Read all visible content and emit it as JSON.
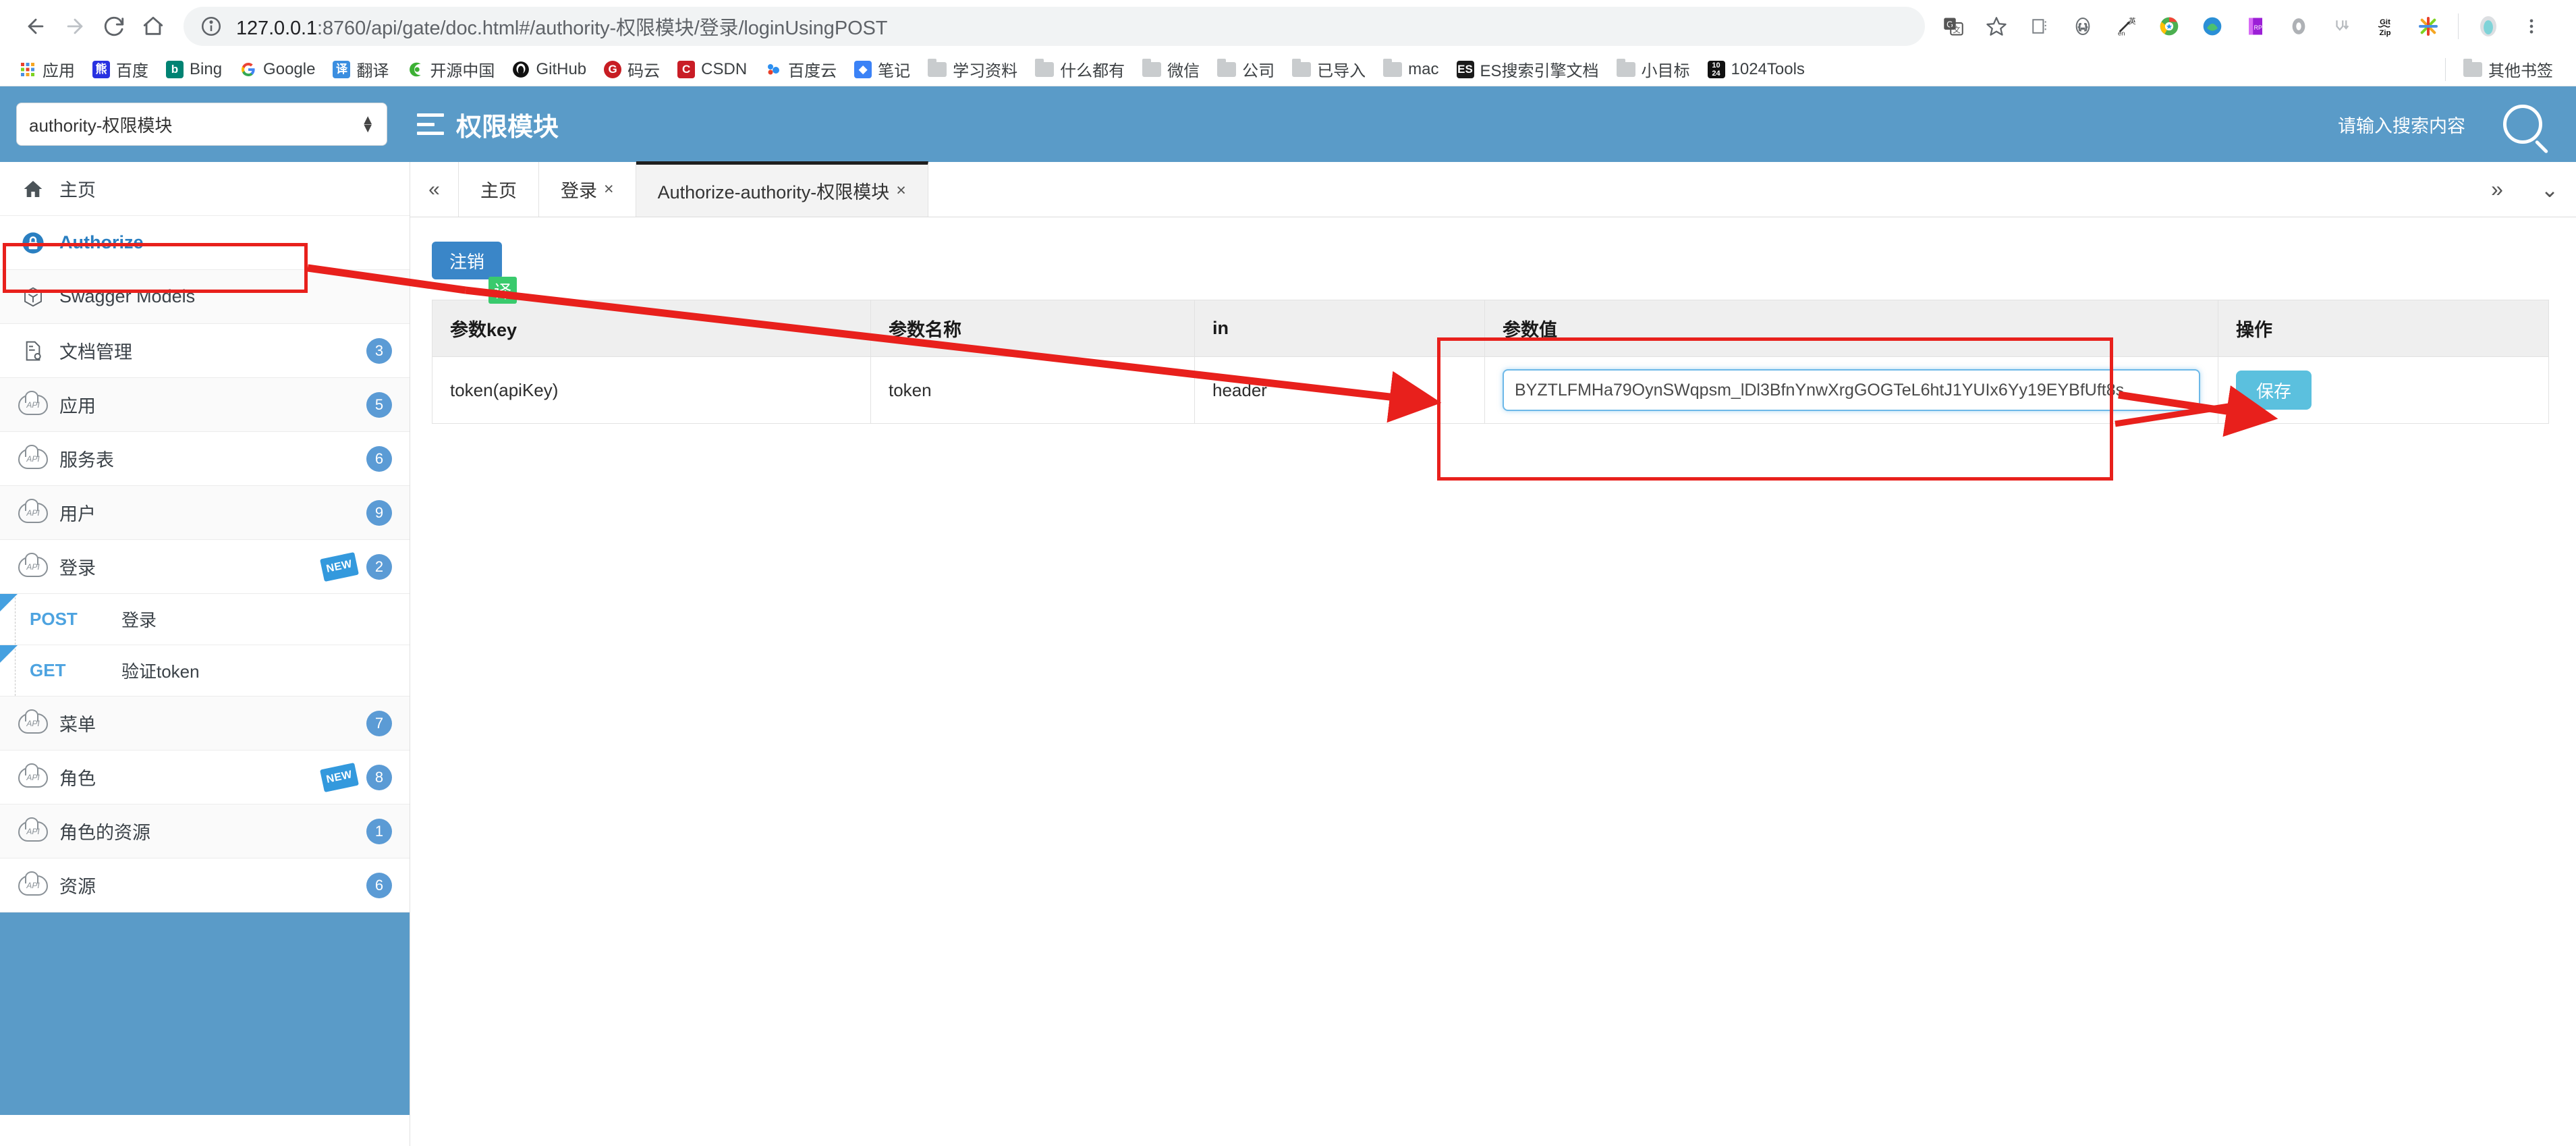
{
  "browser": {
    "nav": {
      "back_icon": "arrow-left-icon",
      "forward_icon": "arrow-right-icon",
      "reload_icon": "reload-icon",
      "home_icon": "home-icon"
    },
    "omnibox": {
      "info_icon": "info-circle-icon",
      "url_host": "127.0.0.1",
      "url_rest": ":8760/api/gate/doc.html#/authority-权限模块/登录/loginUsingPOST",
      "url_full": "127.0.0.1:8760/api/gate/doc.html#/authority-权限模块/登录/loginUsingPOST"
    },
    "toolbar_icons": [
      {
        "name": "google-translate-icon",
        "glyph": "G"
      },
      {
        "name": "bookmark-star-icon",
        "glyph": "☆"
      },
      {
        "name": "extension-reader-icon",
        "glyph": "▤"
      },
      {
        "name": "json-viewer-icon",
        "glyph": "{…}"
      },
      {
        "name": "translate-en-icon",
        "glyph": "英"
      },
      {
        "name": "chrome-extension-icon",
        "glyph": "◉"
      },
      {
        "name": "globe-extension-icon",
        "glyph": "◍"
      },
      {
        "name": "rp-extension-icon",
        "glyph": "RP"
      },
      {
        "name": "oval-extension-icon",
        "glyph": "◯"
      },
      {
        "name": "markdown-extension-icon",
        "glyph": "M"
      },
      {
        "name": "gitzip-extension-icon",
        "glyph": "Git Zip"
      },
      {
        "name": "colorful-star-extension-icon",
        "glyph": "✳"
      },
      {
        "name": "profile-avatar-icon",
        "glyph": "●"
      },
      {
        "name": "chrome-menu-icon",
        "glyph": "⋮"
      }
    ]
  },
  "bookmarks": {
    "items": [
      {
        "label": "应用",
        "icon": "apps-grid-icon",
        "color": "#ffffff"
      },
      {
        "label": "百度",
        "icon": "baidu-icon",
        "color": "#2932e1"
      },
      {
        "label": "Bing",
        "icon": "bing-icon",
        "color": "#008373"
      },
      {
        "label": "Google",
        "icon": "google-icon",
        "color": "#ffffff"
      },
      {
        "label": "翻译",
        "icon": "translate-icon",
        "color": "#3b8ee0"
      },
      {
        "label": "开源中国",
        "icon": "oschina-icon",
        "color": "#3cb034"
      },
      {
        "label": "GitHub",
        "icon": "github-icon",
        "color": "#111111"
      },
      {
        "label": "码云",
        "icon": "gitee-icon",
        "color": "#c71d23"
      },
      {
        "label": "CSDN",
        "icon": "csdn-icon",
        "color": "#c91d26"
      },
      {
        "label": "百度云",
        "icon": "baiduyun-icon",
        "color": "#2c8ff0"
      },
      {
        "label": "笔记",
        "icon": "note-icon",
        "color": "#3b82f6"
      },
      {
        "label": "学习资料",
        "icon": "folder-icon",
        "color": "#c9ccce"
      },
      {
        "label": "什么都有",
        "icon": "folder-icon",
        "color": "#c9ccce"
      },
      {
        "label": "微信",
        "icon": "folder-icon",
        "color": "#c9ccce"
      },
      {
        "label": "公司",
        "icon": "folder-icon",
        "color": "#c9ccce"
      },
      {
        "label": "已导入",
        "icon": "folder-icon",
        "color": "#c9ccce"
      },
      {
        "label": "mac",
        "icon": "folder-icon",
        "color": "#c9ccce"
      },
      {
        "label": "ES搜索引擎文档",
        "icon": "es-book-icon",
        "color": "#1a1a1a"
      },
      {
        "label": "小目标",
        "icon": "folder-icon",
        "color": "#c9ccce"
      },
      {
        "label": "1024Tools",
        "icon": "tools-1024-icon",
        "color": "#111111"
      }
    ],
    "other": {
      "label": "其他书签",
      "icon": "folder-icon"
    }
  },
  "app_header": {
    "service_select_value": "authority-权限模块",
    "menu_icon": "hamburger-menu-icon",
    "title": "权限模块",
    "search_placeholder": "请输入搜索内容",
    "search_icon": "search-icon",
    "bg_color": "#5a9bc8"
  },
  "sidebar": {
    "items": [
      {
        "label": "主页",
        "icon": "home-icon",
        "badge": "",
        "new": false,
        "active": false
      },
      {
        "label": "Authorize",
        "icon": "lock-icon",
        "badge": "",
        "new": false,
        "active": true
      },
      {
        "label": "Swagger Models",
        "icon": "swagger-models-icon",
        "badge": "",
        "new": false,
        "active": false
      },
      {
        "label": "文档管理",
        "icon": "doc-settings-icon",
        "badge": "3",
        "new": false,
        "active": false
      },
      {
        "label": "应用",
        "icon": "api-cloud-icon",
        "badge": "5",
        "new": false,
        "active": false
      },
      {
        "label": "服务表",
        "icon": "api-cloud-icon",
        "badge": "6",
        "new": false,
        "active": false
      },
      {
        "label": "用户",
        "icon": "api-cloud-icon",
        "badge": "9",
        "new": false,
        "active": false
      },
      {
        "label": "登录",
        "icon": "api-cloud-icon",
        "badge": "2",
        "new": true,
        "active": false
      }
    ],
    "methods": [
      {
        "method": "POST",
        "label": "登录",
        "new": true
      },
      {
        "method": "GET",
        "label": "验证token",
        "new": true
      }
    ],
    "items_after": [
      {
        "label": "菜单",
        "icon": "api-cloud-icon",
        "badge": "7",
        "new": false
      },
      {
        "label": "角色",
        "icon": "api-cloud-icon",
        "badge": "8",
        "new": true
      },
      {
        "label": "角色的资源",
        "icon": "api-cloud-icon",
        "badge": "1",
        "new": false
      },
      {
        "label": "资源",
        "icon": "api-cloud-icon",
        "badge": "6",
        "new": false
      }
    ]
  },
  "tabs": {
    "collapse_icon": "double-chevron-left-icon",
    "items": [
      {
        "label": "主页",
        "closable": false,
        "active": false
      },
      {
        "label": "登录",
        "closable": true,
        "close": "×",
        "active": false
      },
      {
        "label": "Authorize-authority-权限模块",
        "closable": true,
        "close": "×",
        "active": true
      }
    ],
    "expand_icon": "double-chevron-right-icon",
    "more_icon": "double-chevron-down-icon"
  },
  "content": {
    "logout_button": "注销",
    "table": {
      "headers": [
        "参数key",
        "参数名称",
        "in",
        "参数值",
        "操作"
      ],
      "rows": [
        {
          "key": "token(apiKey)",
          "name": "token",
          "in": "header",
          "value": "BYZTLFMHa79OynSWqpsm_lDl3BfnYnwXrgGOGTeL6htJ1YUIx6Yy19EYBfUft8s",
          "action": "保存"
        }
      ]
    },
    "translate_badge": "译"
  },
  "annotations": {
    "highlight_color": "#e8201c",
    "boxes": [
      "authorize-sidebar-item",
      "parameter-value-column"
    ],
    "arrows": [
      "sidebar-to-logout",
      "logout-to-value-header",
      "value-box-to-save"
    ]
  }
}
